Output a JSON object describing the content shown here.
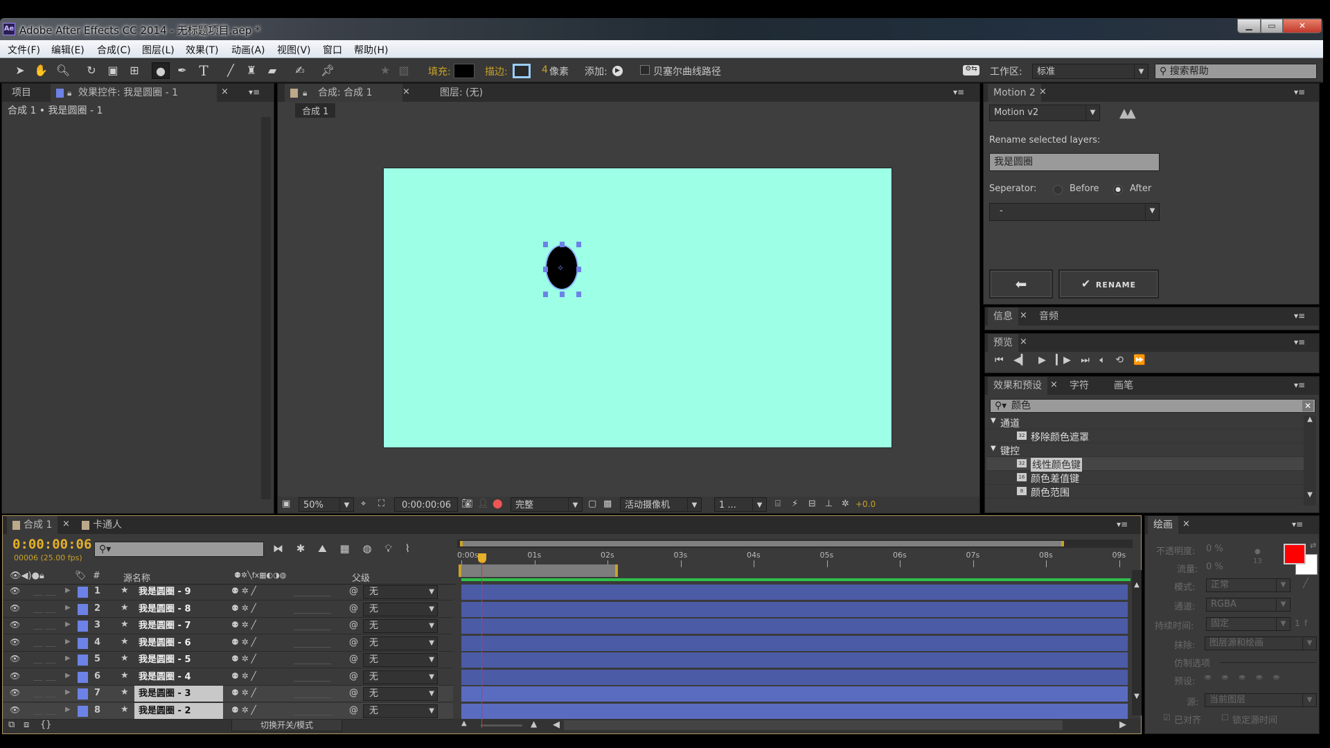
{
  "window": {
    "title": "Adobe After Effects CC 2014 - 无标题项目.aep *",
    "logo": "Ae",
    "controls": [
      "minimize",
      "maximize",
      "close"
    ]
  },
  "menu": [
    "文件(F)",
    "编辑(E)",
    "合成(C)",
    "图层(L)",
    "效果(T)",
    "动画(A)",
    "视图(V)",
    "窗口",
    "帮助(H)"
  ],
  "toolbar": {
    "tools": [
      "selection-tool",
      "hand-tool",
      "zoom-tool",
      "rotate-tool",
      "camera-tool",
      "pan-behind-tool",
      "ellipse-tool",
      "pen-tool",
      "text-tool",
      "brush-tool",
      "clone-stamp-tool",
      "eraser-tool",
      "roto-brush-tool",
      "puppet-pin-tool"
    ],
    "fill_label": "填充:",
    "stroke_label": "描边:",
    "stroke_width": "4",
    "stroke_unit": "像素",
    "add_label": "添加:",
    "bezier_label": "贝塞尔曲线路径",
    "workspace_label": "工作区:",
    "workspace_value": "标准",
    "search_placeholder": "搜索帮助"
  },
  "left_panel": {
    "tabs": [
      "项目",
      "效果控件: 我是圆圈 - 1"
    ],
    "breadcrumb": "合成 1 • 我是圆圈 - 1"
  },
  "comp_panel": {
    "tab": "合成: 合成 1",
    "layer_tab": "图层: (无)",
    "sub_tab": "合成 1",
    "canvas_color": "#9cffe6",
    "footer": {
      "zoom": "50%",
      "timecode": "0:00:00:06",
      "resolution": "完整",
      "camera": "活动摄像机",
      "views": "1 ...",
      "exposure": "+0.0"
    }
  },
  "motion_panel": {
    "tab": "Motion 2",
    "version": "Motion v2",
    "rename_label": "Rename selected layers:",
    "rename_value": "我是圆圈",
    "separator_label": "Seperator:",
    "before_label": "Before",
    "after_label": "After",
    "selected_position": "After",
    "separator_value": "-",
    "rename_button": "RENAME"
  },
  "info_panel": {
    "tabs": [
      "信息",
      "音频"
    ]
  },
  "preview_panel": {
    "tab": "预览"
  },
  "effects_panel": {
    "tabs": [
      "效果和预设",
      "字符",
      "画笔"
    ],
    "search_value": "颜色",
    "tree": [
      {
        "label": "通道",
        "type": "folder"
      },
      {
        "label": "移除颜色遮罩",
        "type": "effect",
        "bits": "32"
      },
      {
        "label": "键控",
        "type": "folder"
      },
      {
        "label": "线性颜色键",
        "type": "effect",
        "bits": "32",
        "selected": true
      },
      {
        "label": "颜色差值键",
        "type": "effect",
        "bits": "16"
      },
      {
        "label": "颜色范围",
        "type": "effect",
        "bits": "8"
      }
    ]
  },
  "timeline": {
    "tabs": [
      "合成 1",
      "卡通人"
    ],
    "timecode": "0:00:00:06",
    "frame_info": "00006 (25.00 fps)",
    "headers": {
      "num": "#",
      "source": "源名称",
      "parent": "父级"
    },
    "ruler": [
      "0:00s",
      "01s",
      "02s",
      "03s",
      "04s",
      "05s",
      "06s",
      "07s",
      "08s",
      "09s"
    ],
    "layers": [
      {
        "num": "1",
        "name": "我是圆圈 - 9",
        "parent": "无"
      },
      {
        "num": "2",
        "name": "我是圆圈 - 8",
        "parent": "无"
      },
      {
        "num": "3",
        "name": "我是圆圈 - 7",
        "parent": "无"
      },
      {
        "num": "4",
        "name": "我是圆圈 - 6",
        "parent": "无"
      },
      {
        "num": "5",
        "name": "我是圆圈 - 5",
        "parent": "无"
      },
      {
        "num": "6",
        "name": "我是圆圈 - 4",
        "parent": "无"
      },
      {
        "num": "7",
        "name": "我是圆圈 - 3",
        "parent": "无"
      },
      {
        "num": "8",
        "name": "我是圆圈 - 2",
        "parent": "无"
      }
    ],
    "toggle_label": "切换开关/模式"
  },
  "paint_panel": {
    "tab": "绘画",
    "opacity_label": "不透明度:",
    "opacity_value": "0 %",
    "flow_label": "流量:",
    "flow_value": "0 %",
    "brush_size": "13",
    "mode_label": "模式:",
    "mode_value": "正常",
    "channel_label": "通道:",
    "channel_value": "RGBA",
    "duration_label": "持续时间:",
    "duration_value": "固定",
    "duration_frames": "1",
    "duration_unit": "f",
    "erase_label": "抹除:",
    "erase_value": "图层源和绘画",
    "clone_label": "仿制选项",
    "preset_label": "预设:",
    "source_label": "源:",
    "source_value": "当前图层",
    "aligned_label": "已对齐",
    "lock_label": "锁定源时间",
    "fg_color": "#ff0000",
    "bg_color": "#ffffff"
  }
}
